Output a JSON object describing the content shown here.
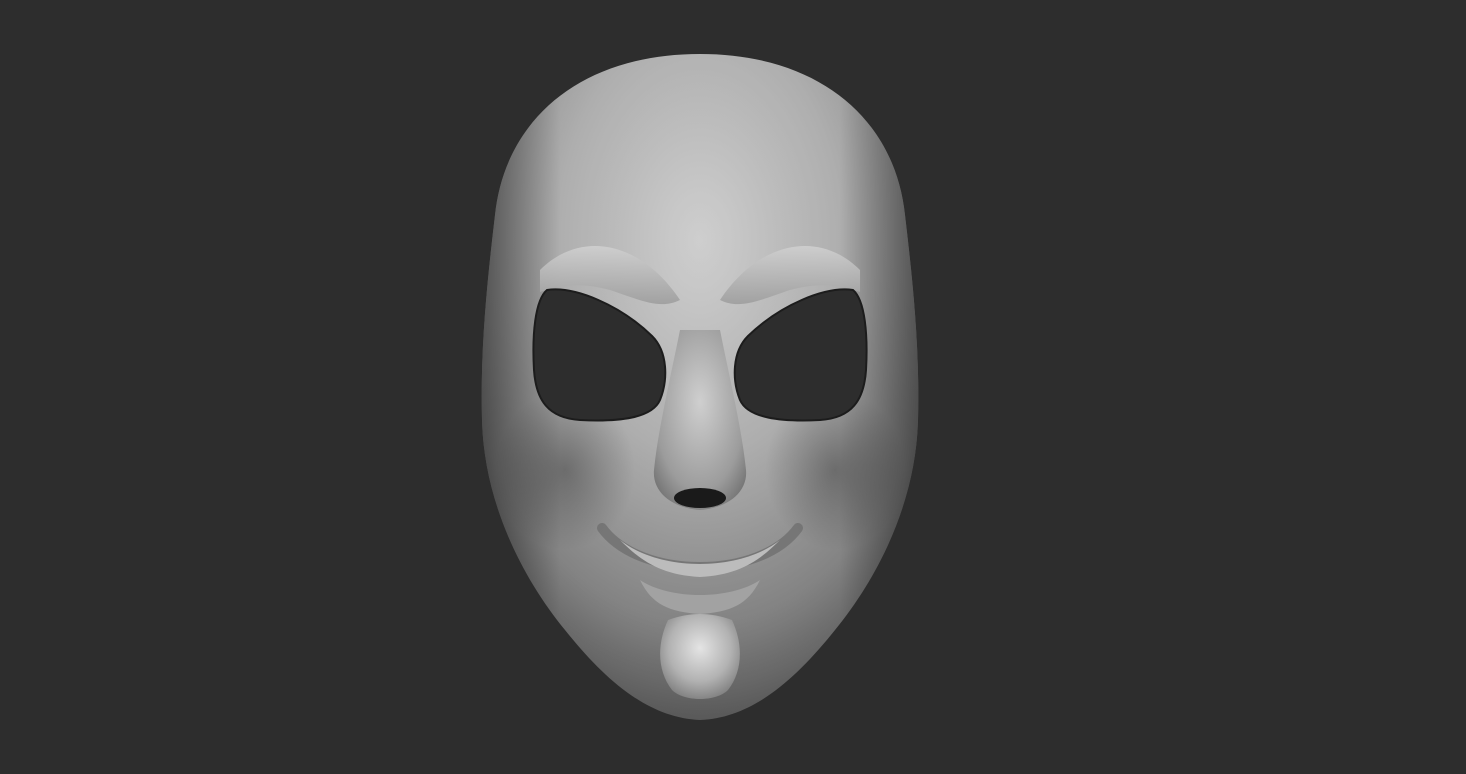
{
  "scene": {
    "background_color": "#2d2d2d",
    "subject": "sculpted-mask",
    "material_colors": {
      "highlight": "#d8d8d8",
      "mid": "#a6a6a6",
      "shadow": "#5b5b5b",
      "deep": "#2a2a2a"
    }
  }
}
